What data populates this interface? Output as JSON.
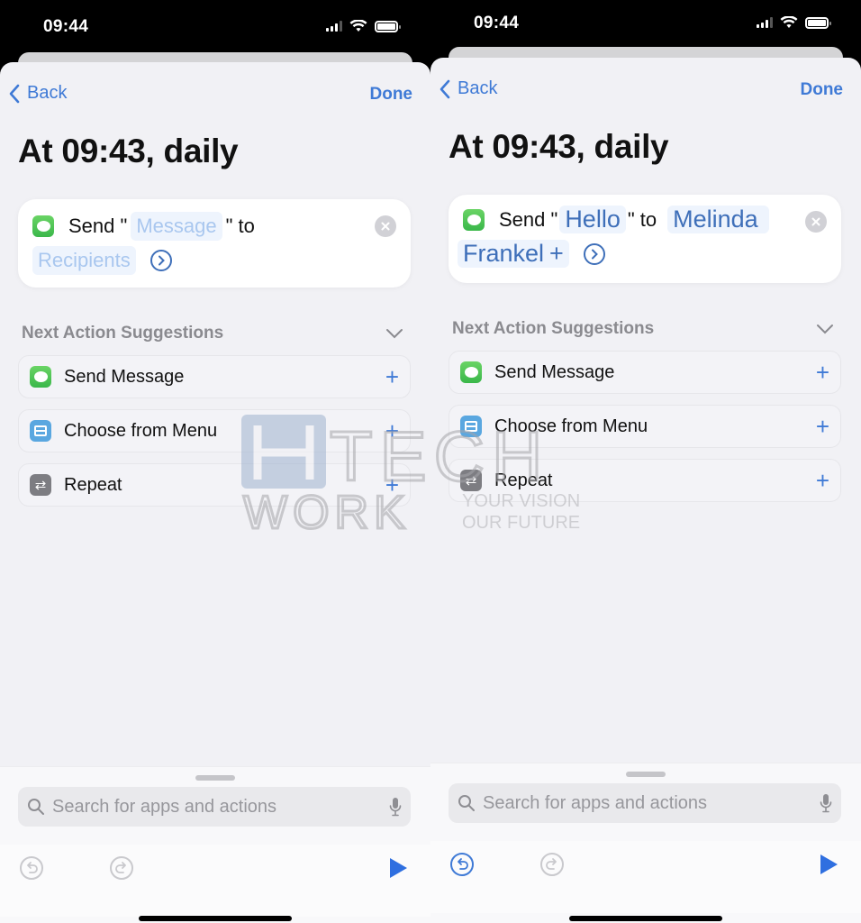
{
  "screens": [
    {
      "status": {
        "time": "09:44"
      },
      "nav": {
        "back_label": "Back",
        "done_label": "Done"
      },
      "title": "At 09:43, daily",
      "action": {
        "send_label": "Send \"",
        "to_label": "\" to",
        "message_token": "Message",
        "message_state": "placeholder",
        "recipients_token": "Recipients",
        "recipients_state": "placeholder"
      },
      "suggestions": {
        "title": "Next Action Suggestions",
        "items": [
          {
            "label": "Send Message",
            "icon": "messages-icon"
          },
          {
            "label": "Choose from Menu",
            "icon": "menu-icon"
          },
          {
            "label": "Repeat",
            "icon": "repeat-icon"
          }
        ]
      },
      "search": {
        "placeholder": "Search for apps and actions",
        "value": ""
      },
      "toolbar": {
        "undo_enabled": false,
        "redo_enabled": false
      }
    },
    {
      "status": {
        "time": "09:44"
      },
      "nav": {
        "back_label": "Back",
        "done_label": "Done"
      },
      "title": "At 09:43, daily",
      "action": {
        "send_label": "Send \"",
        "to_label": "\" to",
        "message_token": "Hello",
        "message_state": "filled",
        "recipients_token_line1": "Melinda",
        "recipients_token_line2": "Frankel",
        "recipients_add": "+",
        "recipients_state": "filled"
      },
      "suggestions": {
        "title": "Next Action Suggestions",
        "items": [
          {
            "label": "Send Message",
            "icon": "messages-icon"
          },
          {
            "label": "Choose from Menu",
            "icon": "menu-icon"
          },
          {
            "label": "Repeat",
            "icon": "repeat-icon"
          }
        ]
      },
      "search": {
        "placeholder": "Search for apps and actions",
        "value": ""
      },
      "toolbar": {
        "undo_enabled": true,
        "redo_enabled": false
      }
    }
  ],
  "watermark": {
    "brand_top": "HITECH",
    "brand_bottom": "WORK",
    "tagline_1": "YOUR VISION",
    "tagline_2": "OUR FUTURE"
  },
  "colors": {
    "accent": "#3f7ad6",
    "token_bg": "#eef4fd",
    "messages_green": "#4cc35a",
    "sheet_bg": "#f1f1f5"
  }
}
